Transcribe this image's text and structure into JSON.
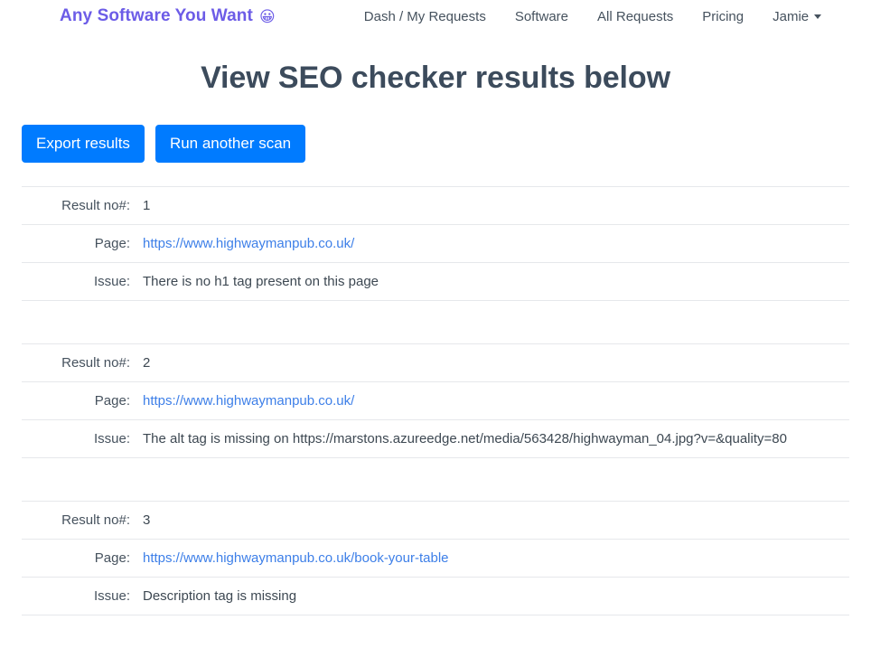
{
  "navbar": {
    "brand": {
      "text": "Any Software You Want",
      "emoji": "😀",
      "emoji_name": "grinning-face-emoji",
      "color": "#6c5ce7"
    },
    "links": [
      {
        "label": "Dash / My Requests"
      },
      {
        "label": "Software"
      },
      {
        "label": "All Requests"
      },
      {
        "label": "Pricing"
      },
      {
        "label": "Jamie",
        "has_caret": true
      }
    ]
  },
  "page": {
    "title": "View SEO checker results below"
  },
  "toolbar": {
    "export_label": "Export results",
    "rescan_label": "Run another scan",
    "button_color": "#007bff"
  },
  "labels": {
    "result_no": "Result no#:",
    "page": "Page:",
    "issue": "Issue:"
  },
  "results": [
    {
      "number": "1",
      "page_url": "https://www.highwaymanpub.co.uk/",
      "issue": "There is no h1 tag present on this page"
    },
    {
      "number": "2",
      "page_url": "https://www.highwaymanpub.co.uk/",
      "issue": "The alt tag is missing on https://marstons.azureedge.net/media/563428/highwayman_04.jpg?v=&quality=80"
    },
    {
      "number": "3",
      "page_url": "https://www.highwaymanpub.co.uk/book-your-table",
      "issue": "Description tag is missing"
    }
  ]
}
